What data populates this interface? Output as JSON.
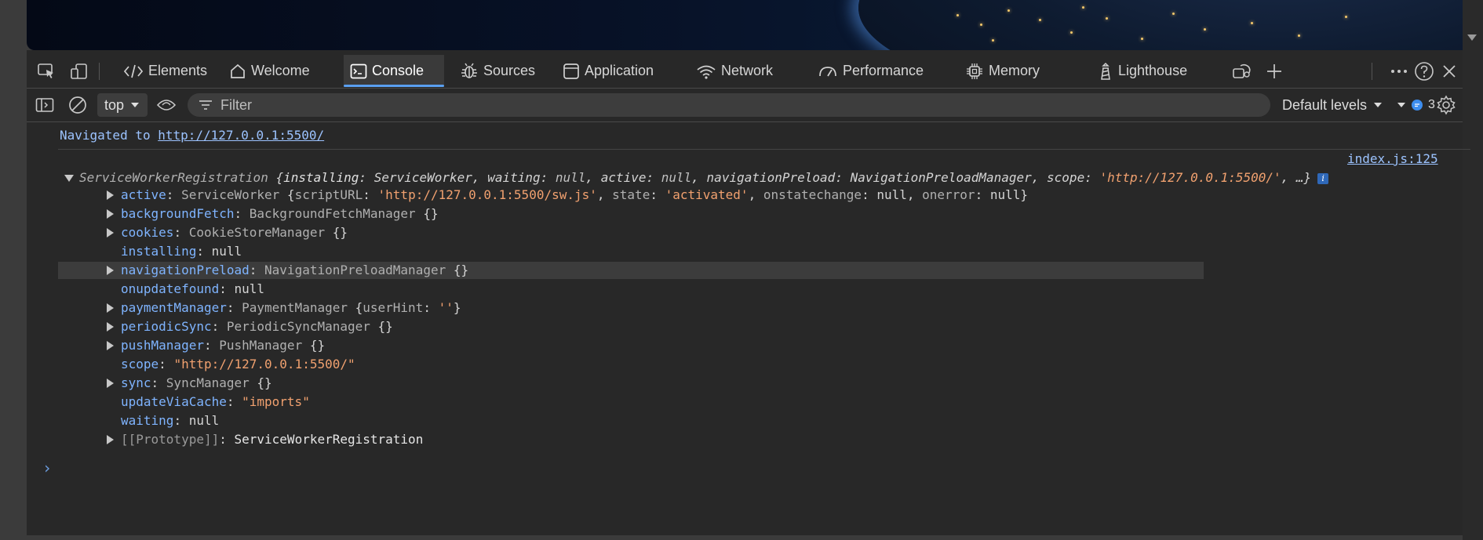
{
  "tabs": [
    {
      "label": "Elements",
      "icon": "code-brackets-icon"
    },
    {
      "label": "Welcome",
      "icon": "home-icon"
    },
    {
      "label": "Console",
      "icon": "console-icon",
      "active": true
    },
    {
      "label": "Sources",
      "icon": "bug-icon"
    },
    {
      "label": "Application",
      "icon": "application-icon"
    },
    {
      "label": "Network",
      "icon": "wifi-icon"
    },
    {
      "label": "Performance",
      "icon": "performance-icon"
    },
    {
      "label": "Memory",
      "icon": "chip-icon"
    },
    {
      "label": "Lighthouse",
      "icon": "lighthouse-icon"
    }
  ],
  "toolbar": {
    "context": "top",
    "filter_placeholder": "Filter",
    "levels_label": "Default levels",
    "issues_count": "3"
  },
  "console": {
    "nav_prefix": "Navigated to ",
    "nav_url": "http://127.0.0.1:5500/",
    "source_link": "index.js:125",
    "object_summary": {
      "class": "ServiceWorkerRegistration",
      "p1k": "installing",
      "p1v": "ServiceWorker",
      "p2k": "waiting",
      "p2v": "null",
      "p3k": "active",
      "p3v": "null",
      "p4k": "navigationPreload",
      "p4v": "NavigationPreloadManager",
      "p5k": "scope",
      "p5v": "'http://127.0.0.1:5500/'",
      "tail": ", …}"
    },
    "active_row": {
      "key": "active",
      "cls": "ServiceWorker",
      "k1": "scriptURL",
      "v1": "'http://127.0.0.1:5500/sw.js'",
      "k2": "state",
      "v2": "'activated'",
      "k3": "onstatechange",
      "v3": "null",
      "k4": "onerror",
      "v4": "null"
    },
    "props": [
      {
        "key": "backgroundFetch",
        "value": "BackgroundFetchManager",
        "suffix": " {}"
      },
      {
        "key": "cookies",
        "value": "CookieStoreManager",
        "suffix": " {}"
      },
      {
        "key": "installing",
        "value": "null"
      },
      {
        "key": "navigationPreload",
        "value": "NavigationPreloadManager",
        "suffix": " {}"
      },
      {
        "key": "onupdatefound",
        "value": "null"
      },
      {
        "key": "paymentManager",
        "value": "PaymentManager",
        "k1": "userHint",
        "v1": "''"
      },
      {
        "key": "periodicSync",
        "value": "PeriodicSyncManager",
        "suffix": " {}"
      },
      {
        "key": "pushManager",
        "value": "PushManager",
        "suffix": " {}"
      },
      {
        "key": "scope",
        "value": "\"http://127.0.0.1:5500/\""
      },
      {
        "key": "sync",
        "value": "SyncManager",
        "suffix": " {}"
      },
      {
        "key": "updateViaCache",
        "value": "\"imports\""
      },
      {
        "key": "waiting",
        "value": "null"
      },
      {
        "key": "[[Prototype]]",
        "value": "ServiceWorkerRegistration"
      }
    ],
    "prompt_symbol": "›"
  }
}
